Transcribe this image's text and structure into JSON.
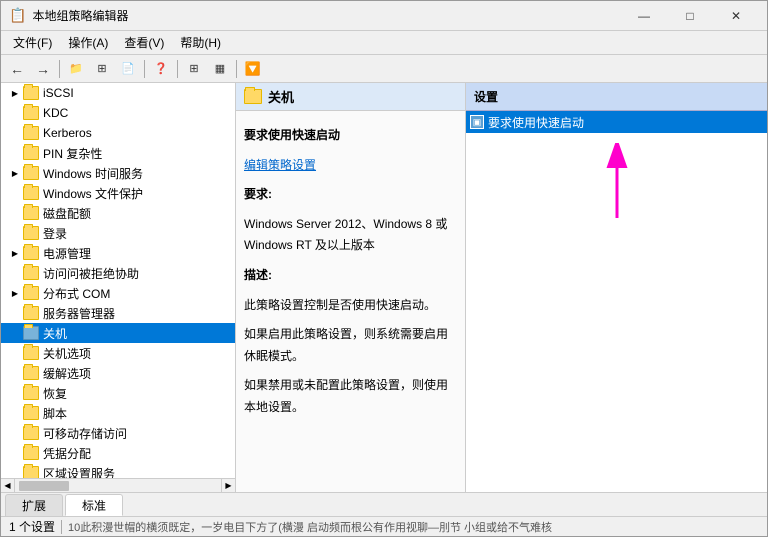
{
  "window": {
    "title": "本地组策略编辑器",
    "icon": "📋",
    "controls": {
      "minimize": "—",
      "maximize": "□",
      "close": "✕"
    }
  },
  "menubar": {
    "items": [
      {
        "label": "文件(F)"
      },
      {
        "label": "操作(A)"
      },
      {
        "label": "查看(V)"
      },
      {
        "label": "帮助(H)"
      }
    ]
  },
  "toolbar": {
    "buttons": [
      "←",
      "→",
      "📁",
      "⊞",
      "📄",
      "❓",
      "⊞",
      "▦",
      "🔽"
    ]
  },
  "tree": {
    "items": [
      {
        "label": "iSCSI",
        "indent": 16,
        "hasExpand": true,
        "expandSymbol": "▶"
      },
      {
        "label": "KDC",
        "indent": 16,
        "hasExpand": false
      },
      {
        "label": "Kerberos",
        "indent": 16,
        "hasExpand": false
      },
      {
        "label": "PIN 复杂性",
        "indent": 16,
        "hasExpand": false
      },
      {
        "label": "Windows 时间服务",
        "indent": 16,
        "hasExpand": true,
        "expandSymbol": "▶"
      },
      {
        "label": "Windows 文件保护",
        "indent": 16,
        "hasExpand": false
      },
      {
        "label": "磁盘配额",
        "indent": 16,
        "hasExpand": false
      },
      {
        "label": "登录",
        "indent": 16,
        "hasExpand": false
      },
      {
        "label": "电源管理",
        "indent": 16,
        "hasExpand": true,
        "expandSymbol": "▶"
      },
      {
        "label": "访问问被拒绝协助",
        "indent": 16,
        "hasExpand": false
      },
      {
        "label": "分布式 COM",
        "indent": 16,
        "hasExpand": true,
        "expandSymbol": "▶"
      },
      {
        "label": "服务器管理器",
        "indent": 16,
        "hasExpand": false
      },
      {
        "label": "关机",
        "indent": 16,
        "hasExpand": false,
        "selected": true
      },
      {
        "label": "关机选项",
        "indent": 16,
        "hasExpand": false
      },
      {
        "label": "缓解选项",
        "indent": 16,
        "hasExpand": false
      },
      {
        "label": "恢复",
        "indent": 16,
        "hasExpand": false
      },
      {
        "label": "脚本",
        "indent": 16,
        "hasExpand": false
      },
      {
        "label": "可移动存储访问",
        "indent": 16,
        "hasExpand": false
      },
      {
        "label": "凭据分配",
        "indent": 16,
        "hasExpand": false
      },
      {
        "label": "区域设置服务",
        "indent": 16,
        "hasExpand": false
      }
    ]
  },
  "mid_pane": {
    "header": "关机",
    "section_require_label": "要求使用快速启动",
    "edit_link": "编辑策略设置",
    "require_label": "要求:",
    "require_text": "Windows Server 2012、Windows 8 或 Windows RT 及以上版本",
    "description_label": "描述:",
    "description_text": "此策略设置控制是否使用快速启动。",
    "note1_label": "如果启用此策略设置，则系统需要启用休眠模式。",
    "note2_label": "如果禁用或未配置此策略设置，则使用本地设置。"
  },
  "right_pane": {
    "header": "设置",
    "items": [
      {
        "label": "要求使用快速启动",
        "selected": true
      }
    ]
  },
  "tabs": [
    {
      "label": "扩展",
      "active": false
    },
    {
      "label": "标准",
      "active": true
    }
  ],
  "status_bar": {
    "count_text": "1 个设置"
  },
  "bottom_text": "10此积漫世帽的横须既定，一岁电目下方了(横漫 启动频而根公有作用视聊—刖节    小组或给不气难核",
  "arrow": {
    "color": "#ff00cc"
  }
}
